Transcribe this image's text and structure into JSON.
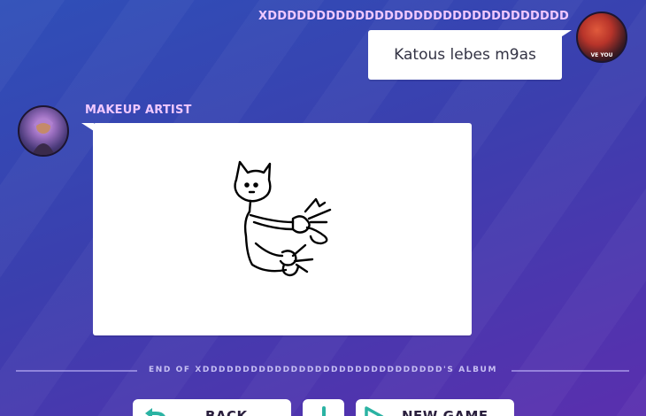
{
  "player_message": {
    "username": "XDDDDDDDDDDDDDDDDDDDDDDDDDDDDDDD",
    "text": "Katous lebes m9as",
    "avatar_caption": "VE YOU"
  },
  "drawing_message": {
    "username": "MAKEUP ARTIST"
  },
  "album": {
    "end_label": "END OF XDDDDDDDDDDDDDDDDDDDDDDDDDDDDDD'S ALBUM"
  },
  "controls": {
    "back_label": "BACK",
    "new_game_label": "NEW GAME",
    "back_icon": "undo-icon",
    "download_icon": "download-icon",
    "new_game_icon": "play-icon"
  },
  "colors": {
    "background_start": "#2f4fb8",
    "background_end": "#5a2fae",
    "username": "#f0c8ff",
    "button_icon": "#2bb3a3"
  }
}
